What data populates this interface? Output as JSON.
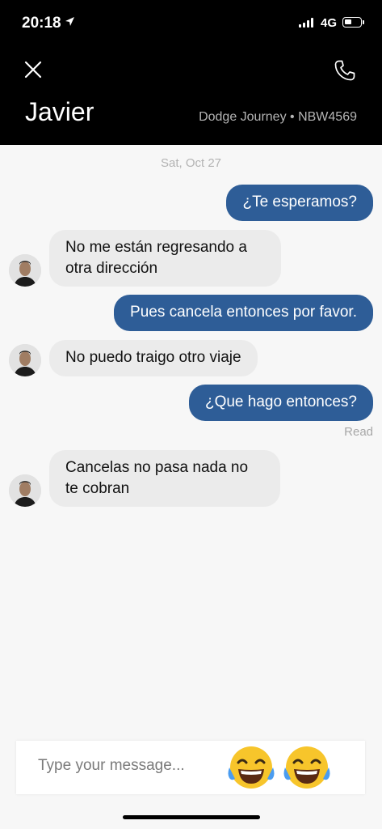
{
  "status_bar": {
    "time": "20:18",
    "network": "4G"
  },
  "header": {
    "driver_name": "Javier",
    "vehicle": "Dodge Journey • NBW4569",
    "close_icon": "close-icon",
    "phone_icon": "phone-icon"
  },
  "chat": {
    "date": "Sat, Oct 27",
    "messages": [
      {
        "direction": "outgoing",
        "lines": [
          "¿Te esperamos?"
        ]
      },
      {
        "direction": "incoming",
        "lines": [
          "No me están regresando a",
          "otra dirección"
        ]
      },
      {
        "direction": "outgoing",
        "lines": [
          "Pues cancela entonces por favor."
        ]
      },
      {
        "direction": "incoming",
        "lines": [
          "No puedo traigo otro viaje"
        ]
      },
      {
        "direction": "outgoing",
        "lines": [
          "¿Que hago entonces?"
        ]
      },
      {
        "direction": "incoming",
        "lines": [
          "Cancelas no pasa nada no",
          "te cobran"
        ]
      }
    ],
    "read_receipt": "Read"
  },
  "composer": {
    "placeholder": "Type your message...",
    "value": "",
    "quick_replies": [
      "face-with-tears-of-joy-emoji",
      "face-with-tears-of-joy-emoji"
    ]
  },
  "colors": {
    "header_bg": "#000000",
    "outgoing_bubble": "#2e5d97",
    "incoming_bubble": "#ebebeb",
    "background": "#f7f7f7"
  }
}
